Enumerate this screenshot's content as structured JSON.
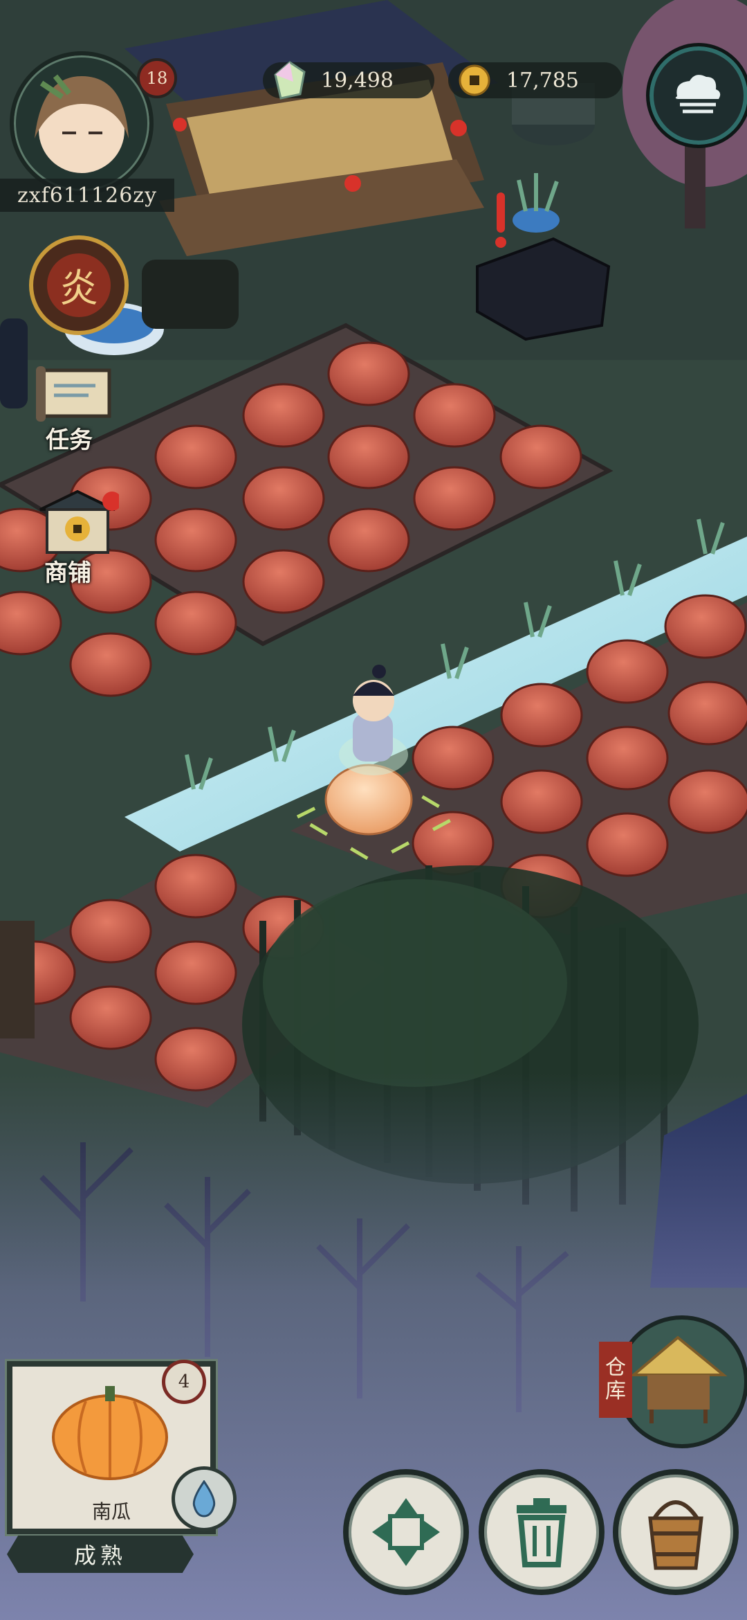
{
  "player": {
    "name": "zxf611126zy",
    "level": "18"
  },
  "currency": {
    "gems": "19,498",
    "coins": "17,785"
  },
  "side_menu": {
    "quest": "任务",
    "shop": "商铺",
    "event_glyph": "炎"
  },
  "seed": {
    "name": "南瓜",
    "count": "4",
    "status": "成熟"
  },
  "warehouse": {
    "label_line1": "仓",
    "label_line2": "库"
  },
  "icons": [
    "avatar",
    "gem-icon",
    "coin-icon",
    "cloud-icon",
    "scroll-icon",
    "shop-icon",
    "water-drop-icon",
    "move-arrows-icon",
    "trash-icon",
    "bucket-icon",
    "hut-icon"
  ],
  "colors": {
    "pumpkin": "#c85a45",
    "ripe_pumpkin": "#f2b27c",
    "stream": "#bfe6ef",
    "alert": "#d8322a"
  }
}
